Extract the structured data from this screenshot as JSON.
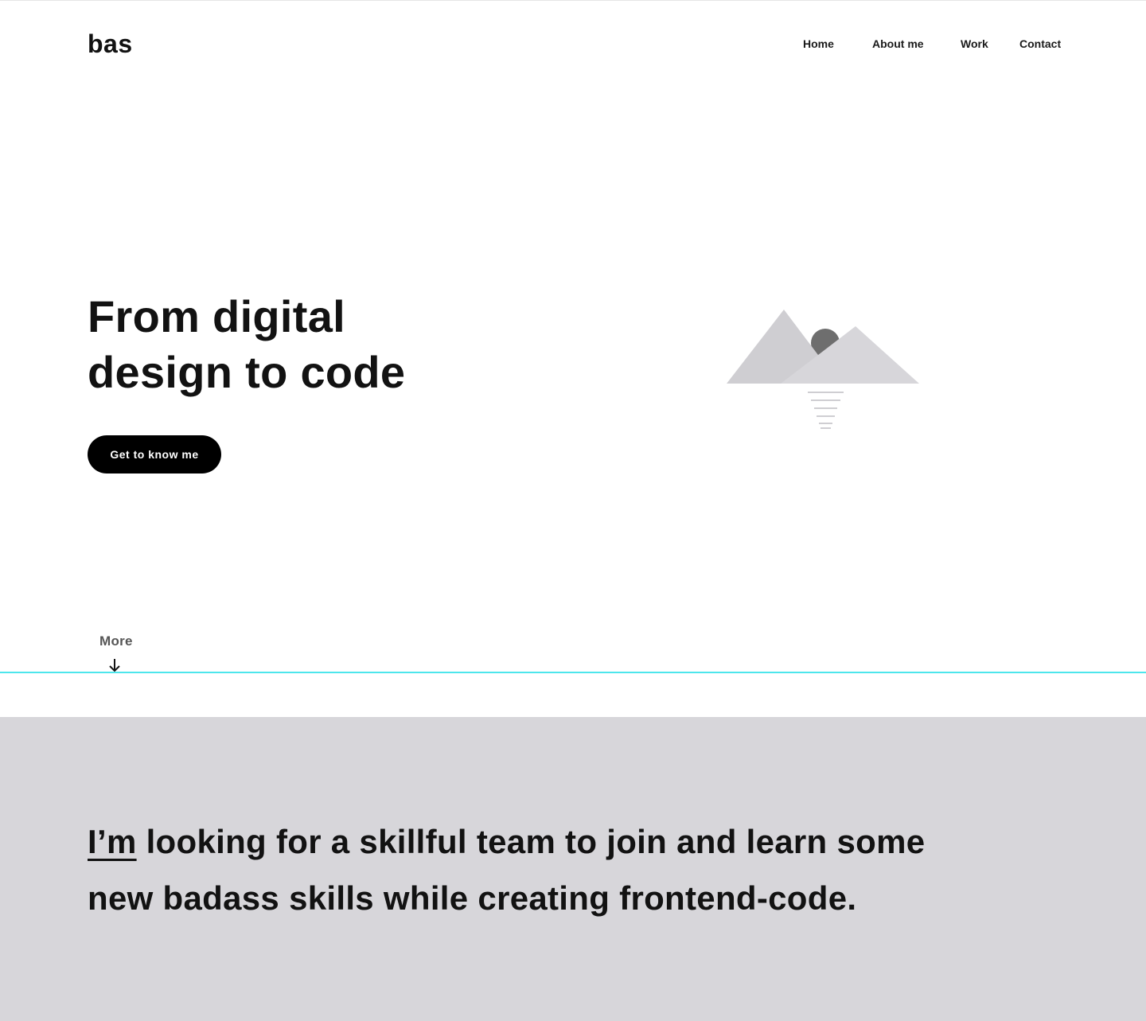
{
  "header": {
    "logo": "bas",
    "nav": {
      "home": "Home",
      "about": "About me",
      "work": "Work",
      "contact": "Contact"
    }
  },
  "hero": {
    "title_line1": "From digital",
    "title_line2": "design to code",
    "cta_label": "Get to know me",
    "illustration_icon": "mountains-sun-icon"
  },
  "more": {
    "label": "More",
    "icon": "arrow-down-icon"
  },
  "about": {
    "highlight": "I’m",
    "line1_rest": " looking for a skillful team to join and learn some",
    "line2": "new badass skills while creating frontend-code."
  },
  "colors": {
    "accent_line": "#4de6ec",
    "section_bg": "#d7d6da",
    "button_bg": "#000000",
    "text": "#121212"
  }
}
